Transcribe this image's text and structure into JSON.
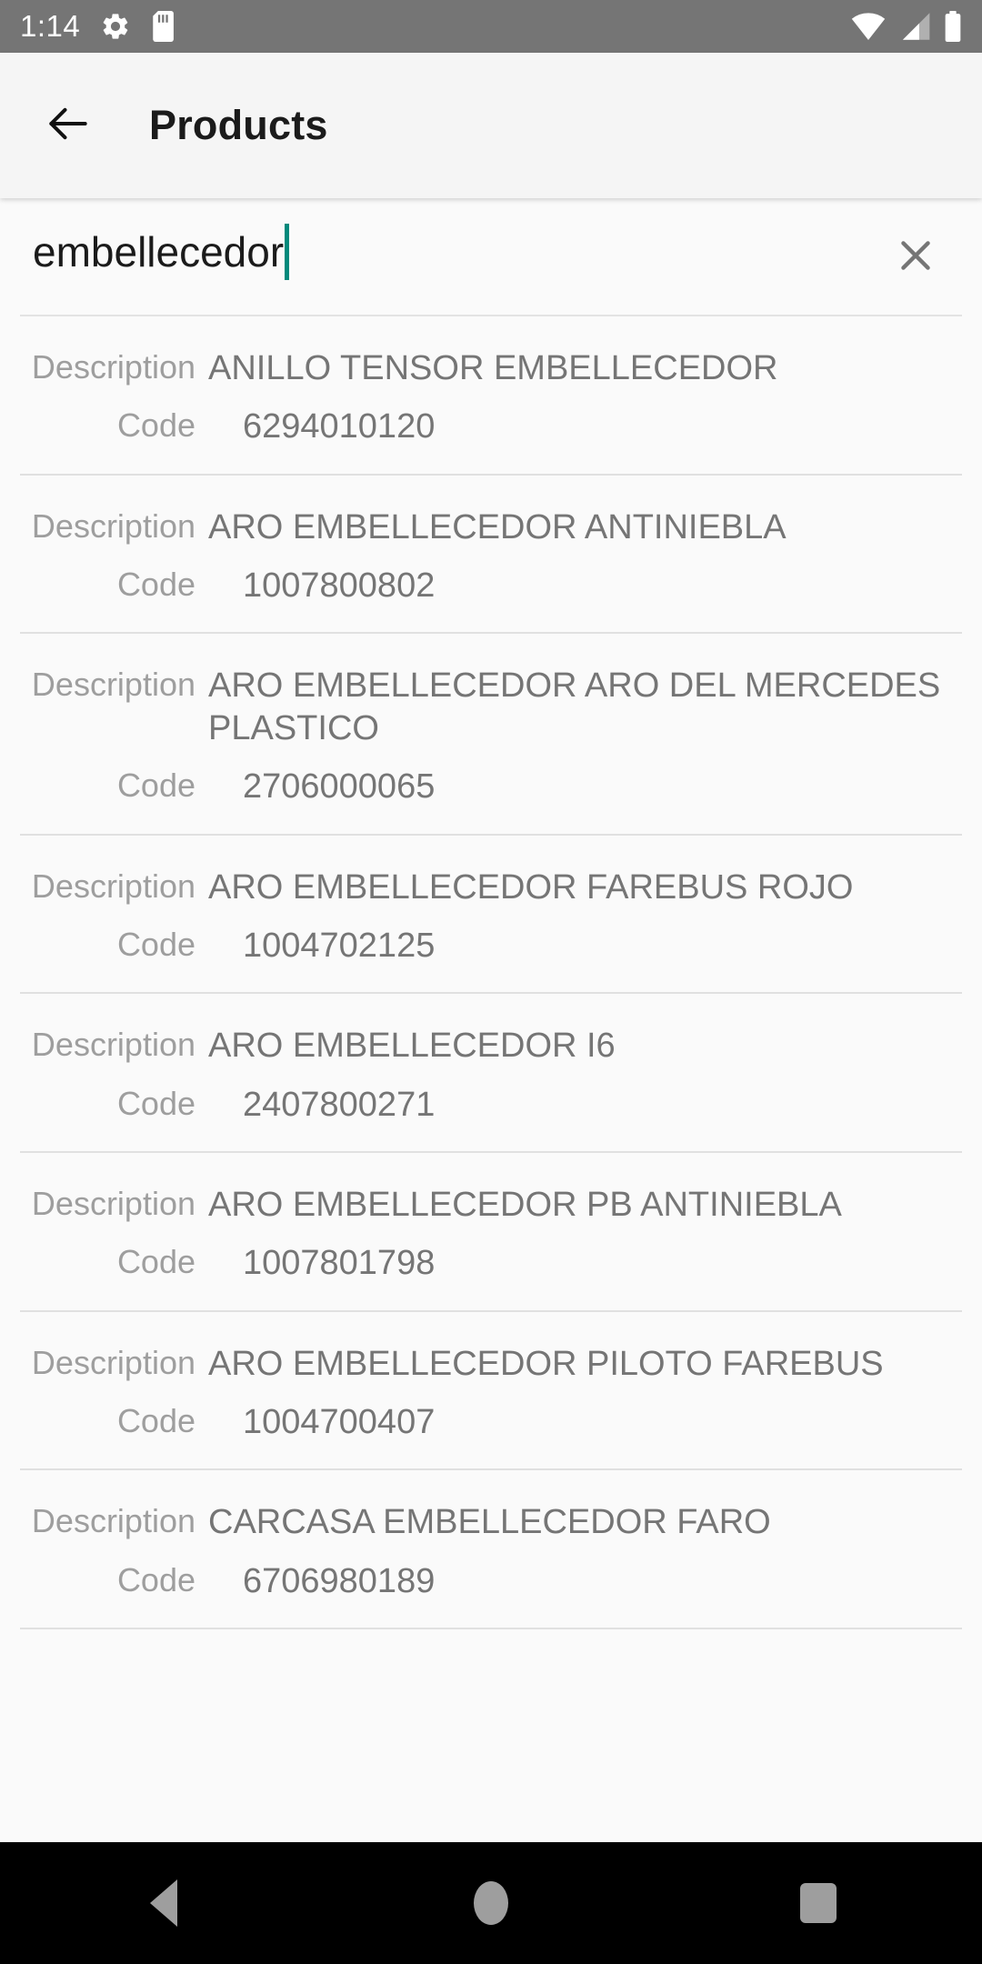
{
  "status_bar": {
    "time": "1:14",
    "left_icons": [
      "gear-icon",
      "sd-card-icon"
    ],
    "right_icons": [
      "wifi-icon",
      "cell-signal-icon",
      "battery-icon"
    ],
    "background_color": "#757575",
    "icon_color": "#ffffff"
  },
  "app_bar": {
    "back_icon": "arrow-left-icon",
    "title": "Products",
    "background_color": "#f5f5f5"
  },
  "search": {
    "value": "embellecedor",
    "placeholder": "Search",
    "clear_icon": "close-icon",
    "caret_color": "#00897b"
  },
  "list": {
    "label_description": "Description",
    "label_code": "Code",
    "items": [
      {
        "description": "ANILLO TENSOR EMBELLECEDOR",
        "code": "6294010120"
      },
      {
        "description": "ARO EMBELLECEDOR ANTINIEBLA",
        "code": "1007800802"
      },
      {
        "description": "ARO EMBELLECEDOR ARO DEL MERCEDES PLASTICO",
        "code": "2706000065"
      },
      {
        "description": "ARO EMBELLECEDOR FAREBUS ROJO",
        "code": "1004702125"
      },
      {
        "description": "ARO EMBELLECEDOR I6",
        "code": "2407800271"
      },
      {
        "description": "ARO EMBELLECEDOR PB ANTINIEBLA",
        "code": "1007801798"
      },
      {
        "description": "ARO EMBELLECEDOR PILOTO FAREBUS",
        "code": "1004700407"
      },
      {
        "description": "CARCASA EMBELLECEDOR FARO",
        "code": "6706980189"
      }
    ]
  },
  "nav_bar": {
    "back_label": "back-triangle-icon",
    "home_label": "home-circle-icon",
    "recents_label": "recents-square-icon",
    "background_color": "#000000"
  }
}
